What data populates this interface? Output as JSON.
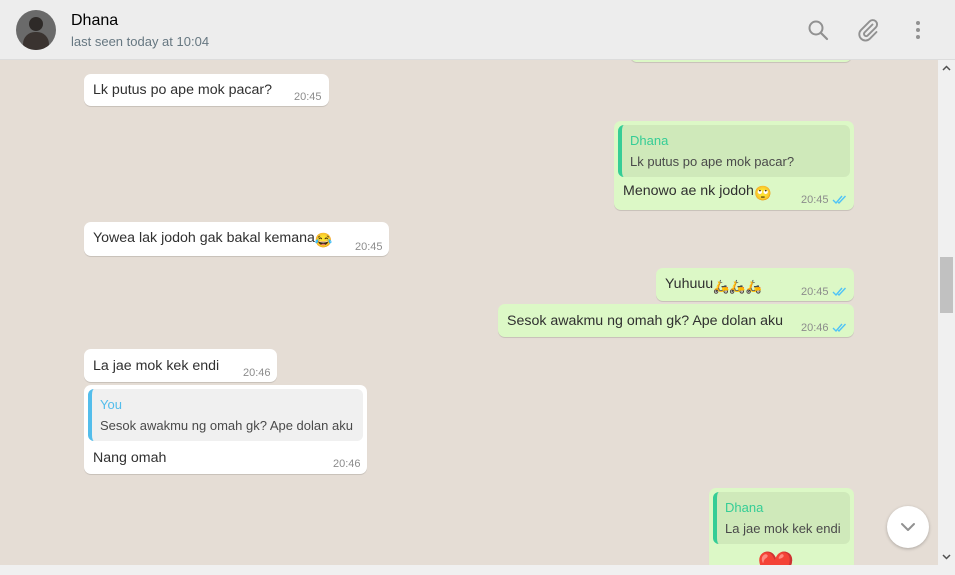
{
  "header": {
    "name": "Dhana",
    "status": "last seen today at 10:04",
    "icons": [
      "search-icon",
      "paperclip-icon",
      "kebab-menu-icon"
    ]
  },
  "messages": [
    {
      "dir": "in",
      "text": "Lk putus po ape mok pacar?",
      "time": "20:45"
    },
    {
      "dir": "out",
      "quote_name": "Dhana",
      "quote_text": "Lk putus po ape mok pacar?",
      "text": "Menowo ae nk jodoh",
      "emoji": "🙄",
      "time": "20:45"
    },
    {
      "dir": "in",
      "text": "Yowea lak jodoh gak bakal kemana",
      "emoji": "😂",
      "time": "20:45"
    },
    {
      "dir": "out",
      "text": "Yuhuuu",
      "emoji": "🛵🛵🛵",
      "time": "20:45"
    },
    {
      "dir": "out",
      "text": "Sesok awakmu ng omah gk? Ape dolan aku",
      "time": "20:46"
    },
    {
      "dir": "in",
      "text": "La jae mok kek endi",
      "time": "20:46"
    },
    {
      "dir": "in",
      "quote_name": "You",
      "quote_text": "Sesok awakmu ng omah gk? Ape dolan aku",
      "text": "Nang omah",
      "time": "20:46"
    },
    {
      "dir": "out",
      "quote_name": "Dhana",
      "quote_text": "La jae mok kek endi",
      "emoji": "❤️"
    }
  ],
  "colors": {
    "header_bg": "#ededed",
    "chat_bg": "#e5ddd5",
    "outgoing_bubble": "#dcf8c6",
    "incoming_bubble": "#ffffff",
    "read_ticks": "#4fc3f7",
    "quote_name_green": "#35cd96",
    "quote_name_blue": "#53bdeb"
  }
}
